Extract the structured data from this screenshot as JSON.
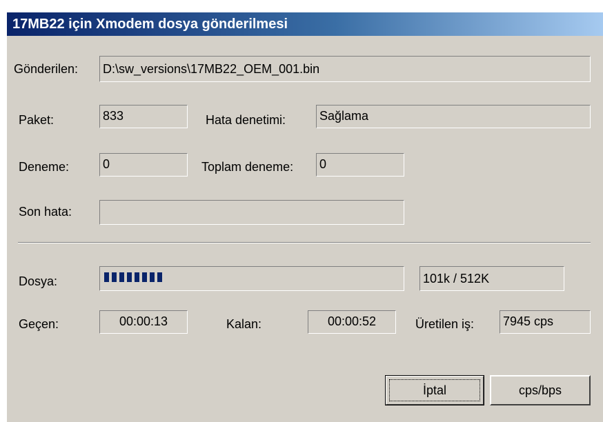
{
  "window": {
    "title": "17MB22 için Xmodem dosya gönderilmesi"
  },
  "send": {
    "label": "Gönderilen:",
    "value": "D:\\sw_versions\\17MB22_OEM_001.bin"
  },
  "packet": {
    "label": "Paket:",
    "value": "833"
  },
  "error_check": {
    "label": "Hata denetimi:",
    "value": "Sağlama"
  },
  "retry": {
    "label": "Deneme:",
    "value": "0"
  },
  "total_retries": {
    "label": "Toplam deneme:",
    "value": "0"
  },
  "last_error": {
    "label": "Son hata:",
    "value": ""
  },
  "file": {
    "label": "Dosya:",
    "size_value": "101k / 512K",
    "progress_fraction": 0.197
  },
  "elapsed": {
    "label": "Geçen:",
    "value": "00:00:13"
  },
  "remaining": {
    "label": "Kalan:",
    "value": "00:00:52"
  },
  "throughput": {
    "label": "Üretilen iş:",
    "value": "7945 cps"
  },
  "buttons": {
    "cancel": "İptal",
    "toggle_units": "cps/bps"
  },
  "colors": {
    "titlebar_start": "#0a246a",
    "titlebar_end": "#a6caf0",
    "face": "#d4d0c8",
    "progress": "#0a246a"
  }
}
